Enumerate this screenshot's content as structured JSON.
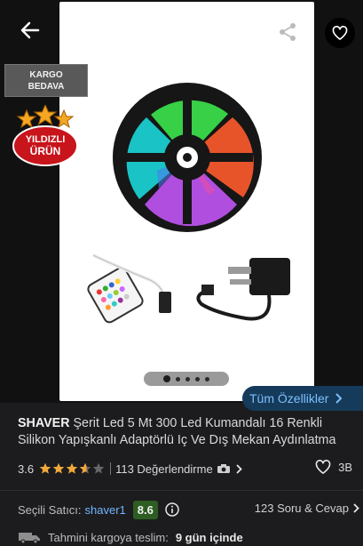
{
  "header": {
    "back_icon": "arrow-left-icon",
    "share_icon": "share-icon",
    "favorite_icon": "heart-outline-icon"
  },
  "badges": {
    "cargo_line1": "KARGO",
    "cargo_line2": "BEDAVA",
    "star_line1": "YILDIZLI",
    "star_line2": "ÜRÜN"
  },
  "gallery": {
    "dot_count": 5,
    "active_index": 0,
    "all_features_label": "Tüm Özellikler"
  },
  "product": {
    "brand": "SHAVER",
    "title": "Şerit Led 5 Mt 300 Led Kumandalı 16 Renkli Silikon Yapışkanlı Adaptörlü Iç Ve Dış Mekan Aydınlatma"
  },
  "rating": {
    "score": "3.6",
    "stars_value": 3.6,
    "reviews_label": "113 Değerlendirme",
    "likes": "3B"
  },
  "seller": {
    "label": "Seçili Satıcı:",
    "name": "shaver1",
    "score": "8.6",
    "qa_label": "123 Soru & Cevap"
  },
  "delivery": {
    "label": "Tahmini kargoya teslim:",
    "value": "9 gün içinde"
  },
  "colors": {
    "background": "#1c1c1e",
    "link": "#6fb6ff",
    "star": "#f2a93b",
    "seller_score_bg": "#2d5d22"
  }
}
